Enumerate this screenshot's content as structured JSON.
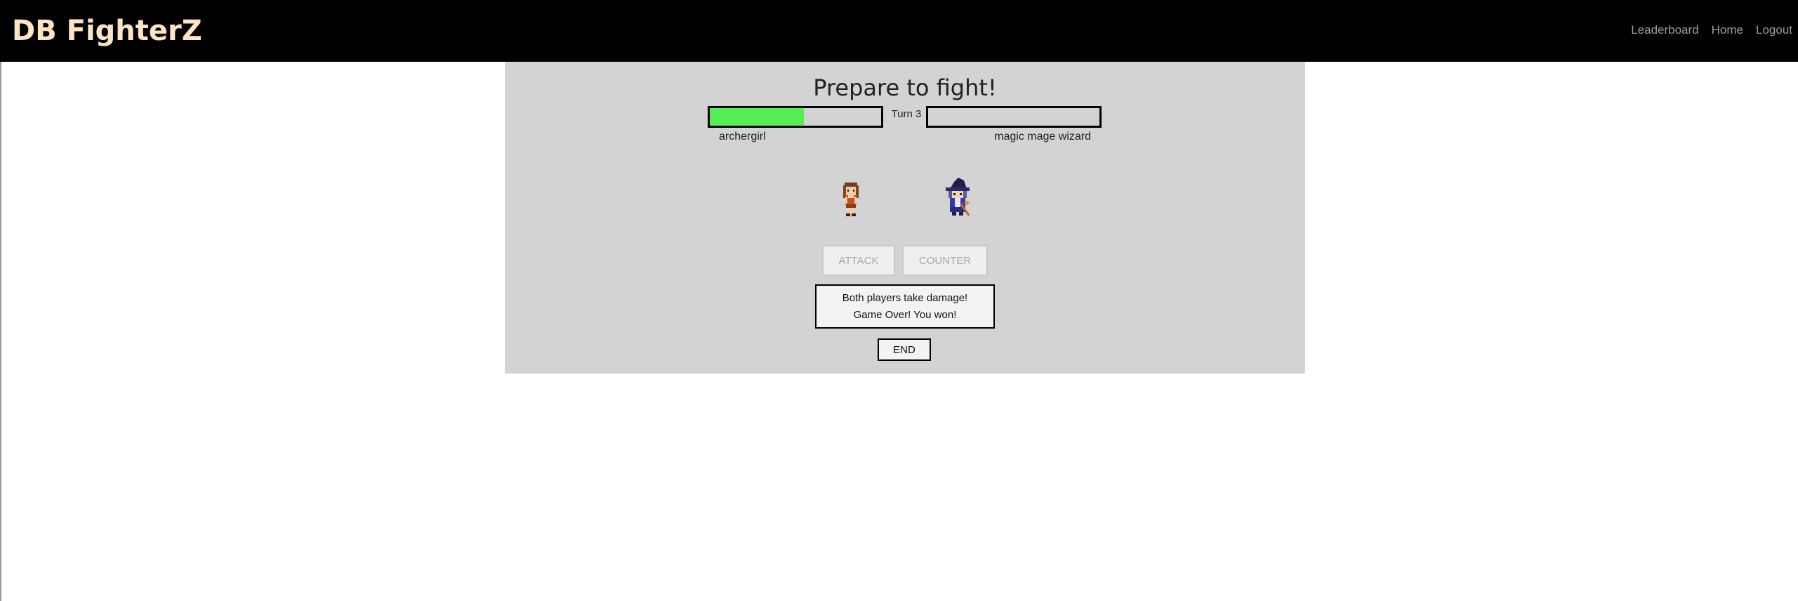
{
  "navbar": {
    "brand": "DB FighterZ",
    "links": [
      "Leaderboard",
      "Home",
      "Logout"
    ]
  },
  "battle": {
    "title": "Prepare to fight!",
    "turn_label": "Turn 3",
    "player_left": {
      "name": "archergirl",
      "hp_fraction": 0.55,
      "bar_color": "#55ee55"
    },
    "player_right": {
      "name": "magic mage wizard",
      "hp_fraction": 0.0
    },
    "actions": {
      "attack_label": "ATTACK",
      "counter_label": "COUNTER"
    },
    "log": [
      "Both players take damage!",
      "Game Over! You won!"
    ],
    "end_label": "END"
  }
}
